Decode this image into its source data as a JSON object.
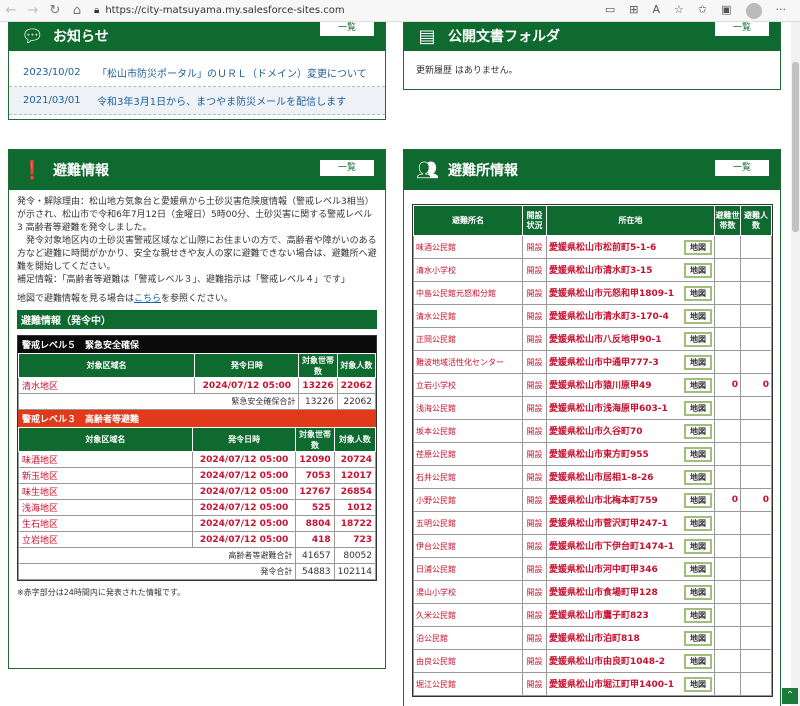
{
  "browser": {
    "url": "https://city-matsuyama.my.salesforce-sites.com"
  },
  "oshirase": {
    "title": "お知らせ",
    "list_label": "一覧",
    "items": [
      {
        "date": "2023/10/02",
        "text": "「松山市防災ポータル」のＵＲＬ（ドメイン）変更について"
      },
      {
        "date": "2021/03/01",
        "text": "令和3年3月1日から、まつやま防災メールを配信します"
      }
    ]
  },
  "kobun": {
    "title": "公開文書フォルダ",
    "list_label": "一覧",
    "empty_text": "更新履歴 はありません。"
  },
  "hinan": {
    "title": "避難情報",
    "list_label": "一覧",
    "body1": "発令・解除理由：松山地方気象台と愛媛県から土砂災害危険度情報（警戒レベル3相当）が示され、松山市で令和6年7月12日（金曜日）5時00分、土砂災害に関する警戒レベル3 高齢者等避難を発令しました。",
    "body2": "　発令対象地区内の土砂災害警戒区域など山際にお住まいの方で、高齢者や障がいのある方など避難に時間がかかり、安全な親せきや友人の家に避難できない場合は、避難所へ避難を開始してください。",
    "body3": "補足情報：「高齢者等避難は「警戒レベル３」、避難指示は「警戒レベル４」です」",
    "map_prefix": "地図で避難情報を見る場合は",
    "map_link": "こちら",
    "map_suffix": "を参照ください。",
    "section": "避難情報（発令中）",
    "headers": {
      "area": "対象区域名",
      "date": "発令日時",
      "households": "対象世帯数",
      "people": "対象人数"
    },
    "lv5": {
      "label": "警戒レベル５　緊急安全確保",
      "rows": [
        {
          "area": "清水地区",
          "date": "2024/07/12 05:00",
          "households": "13226",
          "people": "22062"
        }
      ],
      "sum_label": "緊急安全確保合計",
      "sum_h": "13226",
      "sum_p": "22062"
    },
    "lv3": {
      "label": "警戒レベル３　高齢者等避難",
      "rows": [
        {
          "area": "味酒地区",
          "date": "2024/07/12 05:00",
          "households": "12090",
          "people": "20724"
        },
        {
          "area": "新玉地区",
          "date": "2024/07/12 05:00",
          "households": "7053",
          "people": "12017"
        },
        {
          "area": "味生地区",
          "date": "2024/07/12 05:00",
          "households": "12767",
          "people": "26854"
        },
        {
          "area": "浅海地区",
          "date": "2024/07/12 05:00",
          "households": "525",
          "people": "1012"
        },
        {
          "area": "生石地区",
          "date": "2024/07/12 05:00",
          "households": "8804",
          "people": "18722"
        },
        {
          "area": "立岩地区",
          "date": "2024/07/12 05:00",
          "households": "418",
          "people": "723"
        }
      ],
      "sum_label": "高齢者等避難合計",
      "sum_h": "41657",
      "sum_p": "80052"
    },
    "total_label": "発令合計",
    "total_h": "54883",
    "total_p": "102114",
    "note": "※赤字部分は24時間内に発表された情報です。"
  },
  "shelter": {
    "title": "避難所情報",
    "list_label": "一覧",
    "headers": {
      "name": "避難所名",
      "status": "開設状況",
      "addr": "所在地",
      "households": "避難世帯数",
      "people": "避難人数"
    },
    "map_label": "地図",
    "rows": [
      {
        "name": "味酒公民館",
        "status": "開設",
        "addr": "愛媛県松山市松前町5-1-6",
        "h": "",
        "p": ""
      },
      {
        "name": "清水小学校",
        "status": "開設",
        "addr": "愛媛県松山市清水町3-15",
        "h": "",
        "p": ""
      },
      {
        "name": "中島公民館元怒和分館",
        "status": "開設",
        "addr": "愛媛県松山市元怒和甲1809-1",
        "h": "",
        "p": ""
      },
      {
        "name": "清水公民館",
        "status": "開設",
        "addr": "愛媛県松山市清水町3-170-4",
        "h": "",
        "p": ""
      },
      {
        "name": "正岡公民館",
        "status": "開設",
        "addr": "愛媛県松山市八反地甲90-1",
        "h": "",
        "p": ""
      },
      {
        "name": "難波地域活性化センター",
        "status": "開設",
        "addr": "愛媛県松山市中通甲777-3",
        "h": "",
        "p": ""
      },
      {
        "name": "立岩小学校",
        "status": "開設",
        "addr": "愛媛県松山市猿川原甲49",
        "h": "0",
        "p": "0"
      },
      {
        "name": "浅海公民館",
        "status": "開設",
        "addr": "愛媛県松山市浅海原甲603-1",
        "h": "",
        "p": ""
      },
      {
        "name": "坂本公民館",
        "status": "開設",
        "addr": "愛媛県松山市久谷町70",
        "h": "",
        "p": ""
      },
      {
        "name": "荏原公民館",
        "status": "開設",
        "addr": "愛媛県松山市東方町955",
        "h": "",
        "p": ""
      },
      {
        "name": "石井公民館",
        "status": "開設",
        "addr": "愛媛県松山市居相1-8-26",
        "h": "",
        "p": ""
      },
      {
        "name": "小野公民館",
        "status": "開設",
        "addr": "愛媛県松山市北梅本町759",
        "h": "0",
        "p": "0"
      },
      {
        "name": "五明公民館",
        "status": "開設",
        "addr": "愛媛県松山市菅沢町甲247-1",
        "h": "",
        "p": ""
      },
      {
        "name": "伊台公民館",
        "status": "開設",
        "addr": "愛媛県松山市下伊台町1474-1",
        "h": "",
        "p": ""
      },
      {
        "name": "日浦公民館",
        "status": "開設",
        "addr": "愛媛県松山市河中町甲346",
        "h": "",
        "p": ""
      },
      {
        "name": "湯山小学校",
        "status": "開設",
        "addr": "愛媛県松山市食場町甲128",
        "h": "",
        "p": ""
      },
      {
        "name": "久米公民館",
        "status": "開設",
        "addr": "愛媛県松山市鷹子町823",
        "h": "",
        "p": ""
      },
      {
        "name": "泊公民館",
        "status": "開設",
        "addr": "愛媛県松山市泊町818",
        "h": "",
        "p": ""
      },
      {
        "name": "由良公民館",
        "status": "開設",
        "addr": "愛媛県松山市由良町1048-2",
        "h": "",
        "p": ""
      },
      {
        "name": "堀江公民館",
        "status": "開設",
        "addr": "愛媛県松山市堀江町甲1400-1",
        "h": "",
        "p": ""
      }
    ]
  }
}
